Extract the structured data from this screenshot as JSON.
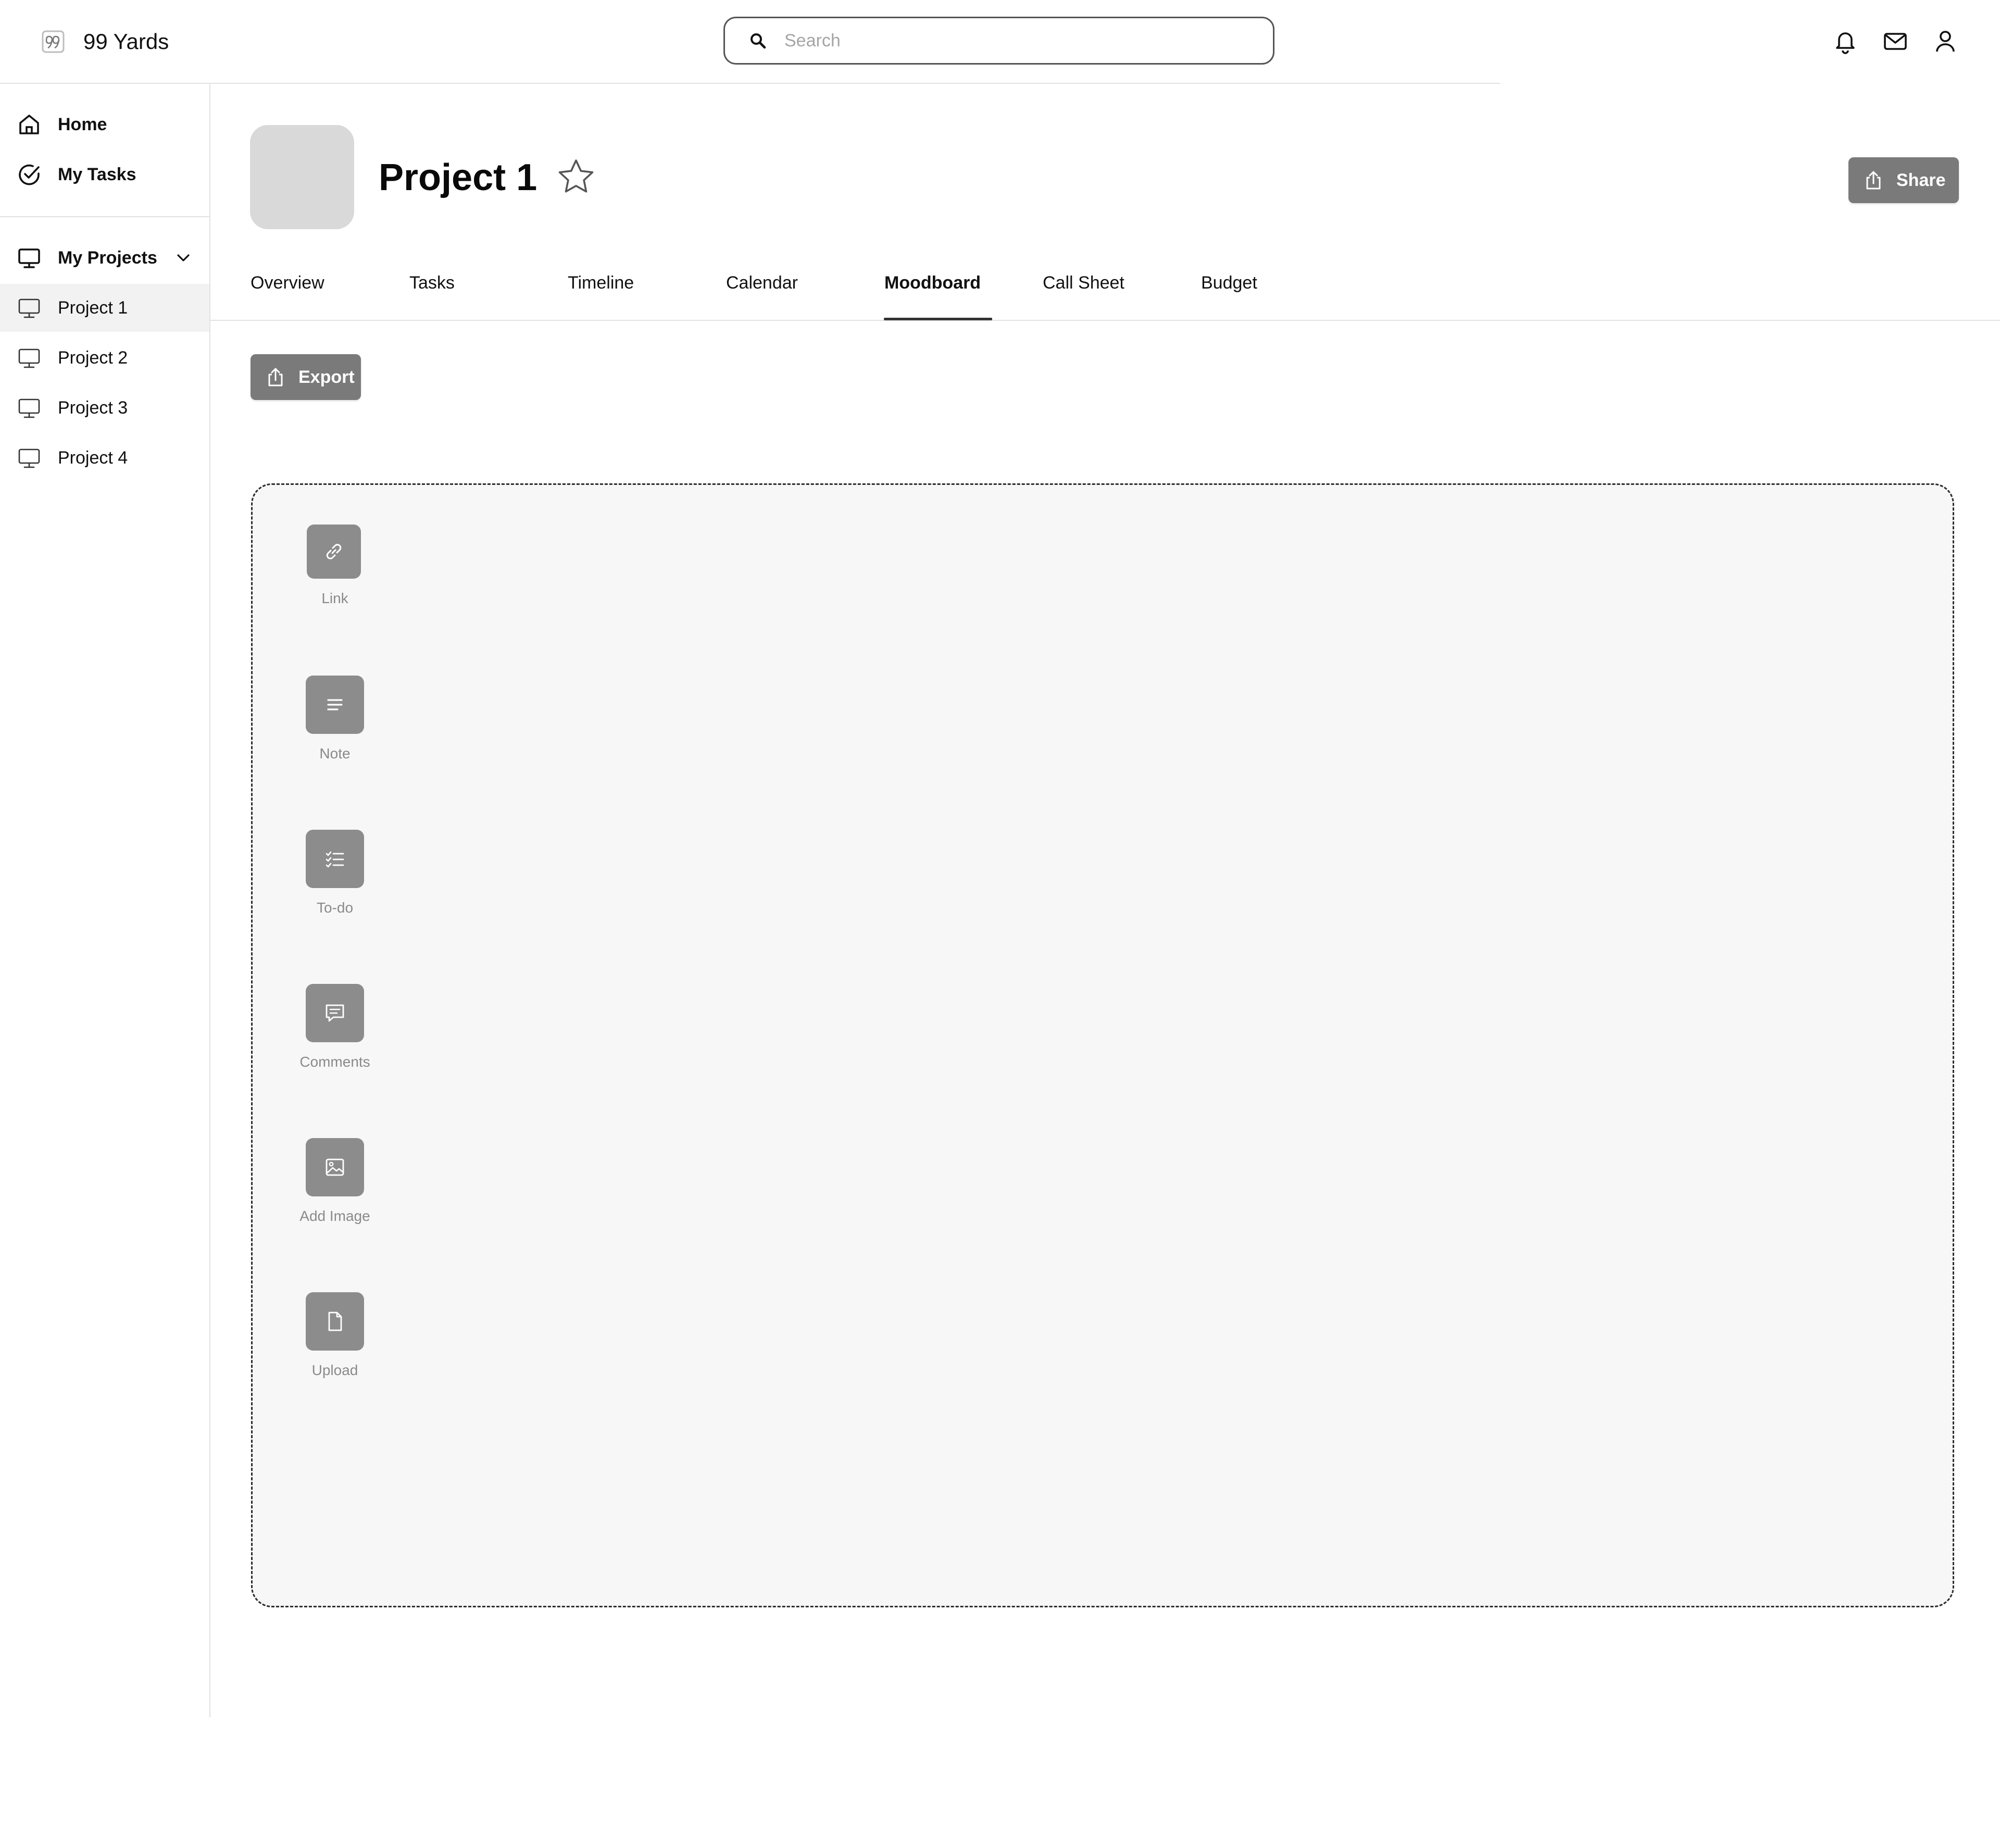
{
  "app": {
    "name": "99 Yards"
  },
  "search": {
    "placeholder": "Search"
  },
  "sidebar": {
    "home": "Home",
    "my_tasks": "My Tasks",
    "my_projects": "My Projects",
    "projects": [
      "Project 1",
      "Project 2",
      "Project 3",
      "Project 4"
    ]
  },
  "project": {
    "title": "Project 1",
    "share_label": "Share"
  },
  "tabs": [
    {
      "label": "Overview"
    },
    {
      "label": "Tasks"
    },
    {
      "label": "Timeline"
    },
    {
      "label": "Calendar"
    },
    {
      "label": "Moodboard",
      "active": true
    },
    {
      "label": "Call Sheet"
    },
    {
      "label": "Budget"
    }
  ],
  "moodboard": {
    "export_label": "Export",
    "tools": [
      {
        "label": "Link",
        "icon": "link-icon"
      },
      {
        "label": "Note",
        "icon": "note-icon"
      },
      {
        "label": "To-do",
        "icon": "checklist-icon"
      },
      {
        "label": "Comments",
        "icon": "comment-icon"
      },
      {
        "label": "Add Image",
        "icon": "image-icon"
      },
      {
        "label": "Upload",
        "icon": "file-icon"
      }
    ]
  },
  "colors": {
    "button_gray": "#7a7a7a",
    "tool_tile": "#8c8c8c",
    "board_background": "#f7f7f7",
    "active_nav": "#f2f2f2"
  }
}
